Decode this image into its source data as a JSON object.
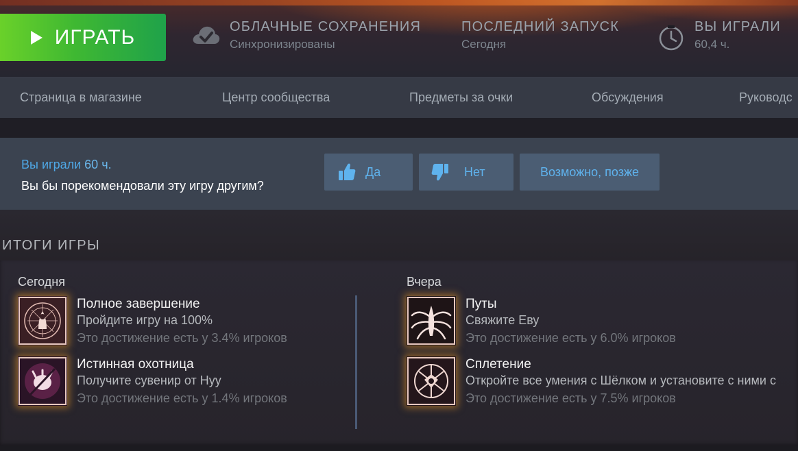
{
  "header": {
    "play_label": "ИГРАТЬ",
    "cloud_title": "ОБЛАЧНЫЕ СОХРАНЕНИЯ",
    "cloud_status": "Синхронизированы",
    "last_launch_title": "ПОСЛЕДНИЙ ЗАПУСК",
    "last_launch_value": "Сегодня",
    "played_title": "ВЫ ИГРАЛИ",
    "played_value": "60,4 ч."
  },
  "nav": {
    "items": [
      {
        "label": "Страница в магазине"
      },
      {
        "label": "Центр сообщества"
      },
      {
        "label": "Предметы за очки"
      },
      {
        "label": "Обсуждения"
      },
      {
        "label": "Руководс"
      }
    ]
  },
  "recommend": {
    "played_prefix": "Вы играли",
    "played_hours": "60 ч.",
    "question": "Вы бы порекомендовали эту игру другим?",
    "yes_label": "Да",
    "no_label": "Нет",
    "later_label": "Возможно, позже"
  },
  "summary": {
    "title": "ИТОГИ ИГРЫ",
    "today_label": "Сегодня",
    "yesterday_label": "Вчера",
    "today": [
      {
        "title": "Полное завершение",
        "desc": "Пройдите игру на 100%",
        "stat": "Это достижение есть у 3.4% игроков",
        "icon": "full-completion-icon"
      },
      {
        "title": "Истинная охотница",
        "desc": "Получите сувенир от Нуу",
        "stat": "Это достижение есть у 1.4% игроков",
        "icon": "true-huntress-icon"
      }
    ],
    "yesterday": [
      {
        "title": "Путы",
        "desc": "Свяжите Еву",
        "stat": "Это достижение есть у 6.0% игроков",
        "icon": "bonds-icon"
      },
      {
        "title": "Сплетение",
        "desc": "Откройте все умения с Шёлком и установите с ними с",
        "stat": "Это достижение есть у 7.5% игроков",
        "icon": "weave-icon"
      }
    ]
  },
  "colors": {
    "play_green": "#3fb832",
    "accent_blue": "#4fa8e6",
    "nav_bg": "#363a45"
  }
}
